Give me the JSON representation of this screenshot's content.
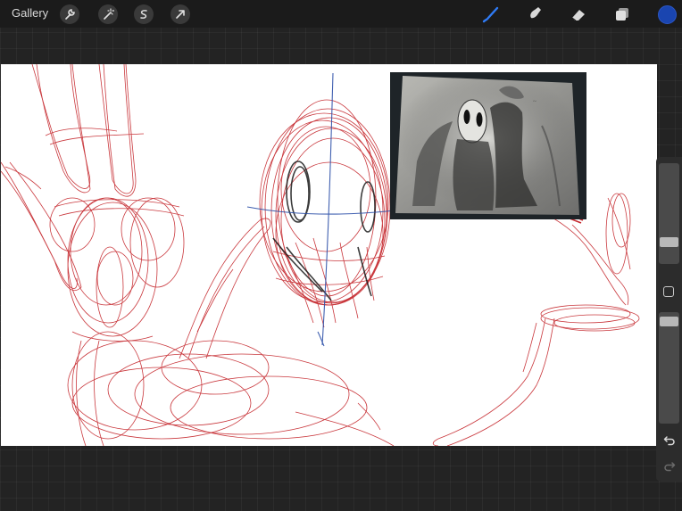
{
  "topbar": {
    "gallery_label": "Gallery",
    "left_tools": [
      "wrench-icon",
      "magic-wand-icon",
      "selection-icon",
      "transform-arrow-icon"
    ],
    "right_tools": [
      "brush-icon",
      "smudge-icon",
      "eraser-icon",
      "layers-icon"
    ],
    "active_tool": "brush-icon",
    "accent_color": "#2f7bf5",
    "current_color": "#1a45b0"
  },
  "canvas": {
    "background": "#ffffff",
    "stroke_color_primary": "#c0161c",
    "stroke_color_guides": "#2c4fa8",
    "reference_image": "pencil-drawing-photo"
  },
  "sidebar": {
    "brush_size_level": 0.25,
    "opacity_level": 0.95,
    "icons": [
      "modify-square-icon",
      "undo-icon",
      "redo-icon"
    ]
  }
}
